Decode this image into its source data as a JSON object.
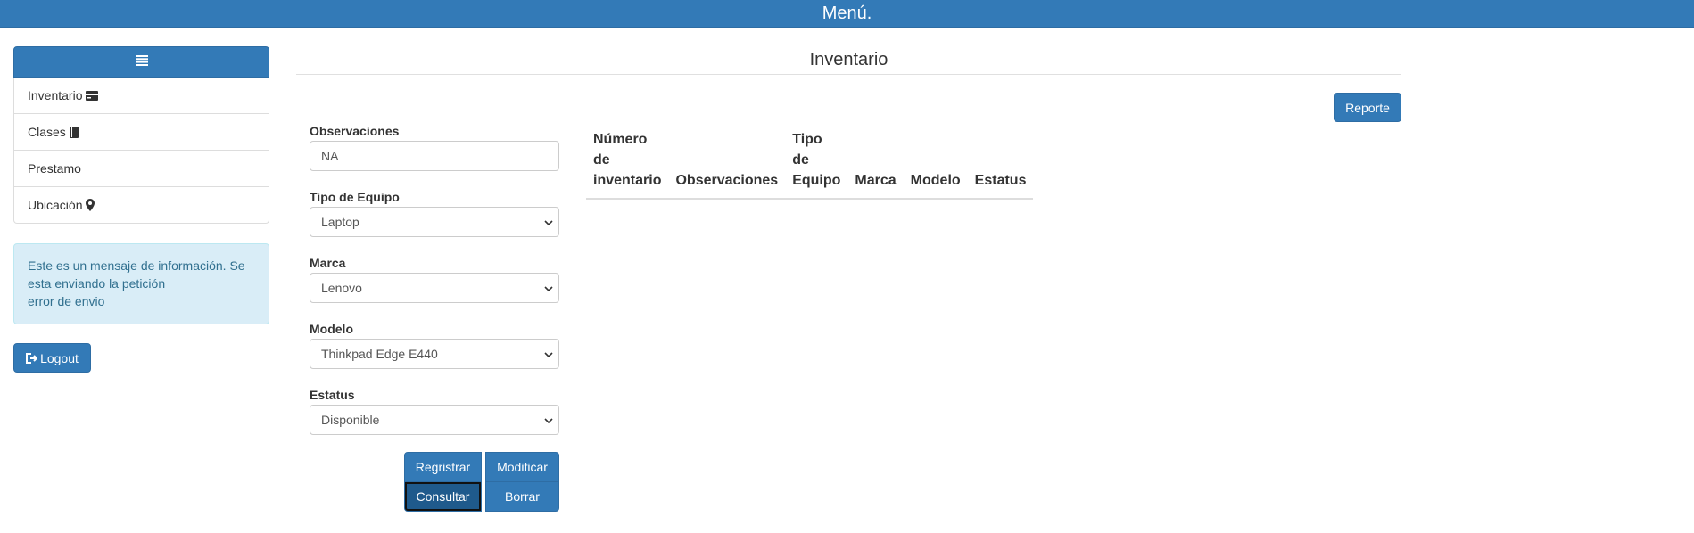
{
  "header": {
    "title": "Menú."
  },
  "sidebar": {
    "menu_icon": "hamburger-list-icon",
    "items": [
      {
        "label": "Inventario",
        "icon": "credit-card-icon"
      },
      {
        "label": "Clases",
        "icon": "book-icon"
      },
      {
        "label": "Prestamo",
        "icon": ""
      },
      {
        "label": "Ubicación",
        "icon": "map-marker-icon"
      }
    ]
  },
  "alert": {
    "line1": "Este es un mensaje de información. Se esta enviando la petición",
    "line2": "error de envio"
  },
  "logout": {
    "label": "Logout",
    "icon": "log-out-icon"
  },
  "main": {
    "title": "Inventario",
    "report_button": "Reporte"
  },
  "form": {
    "observaciones": {
      "label": "Observaciones",
      "value": "NA"
    },
    "tipo_equipo": {
      "label": "Tipo de Equipo",
      "value": "Laptop"
    },
    "marca": {
      "label": "Marca",
      "value": "Lenovo"
    },
    "modelo": {
      "label": "Modelo",
      "value": "Thinkpad Edge E440"
    },
    "estatus": {
      "label": "Estatus",
      "value": "Disponible"
    },
    "buttons": {
      "registrar": "Regristrar",
      "modificar": "Modificar",
      "consultar": "Consultar",
      "borrar": "Borrar"
    }
  },
  "table": {
    "headers": [
      [
        "Número",
        "de",
        "inventario"
      ],
      [
        "Observaciones"
      ],
      [
        "Tipo",
        "de",
        "Equipo"
      ],
      [
        "Marca"
      ],
      [
        "Modelo"
      ],
      [
        "Estatus"
      ]
    ]
  },
  "colors": {
    "primary": "#337ab7",
    "alert_bg": "#d9edf7",
    "alert_text": "#31708f"
  }
}
